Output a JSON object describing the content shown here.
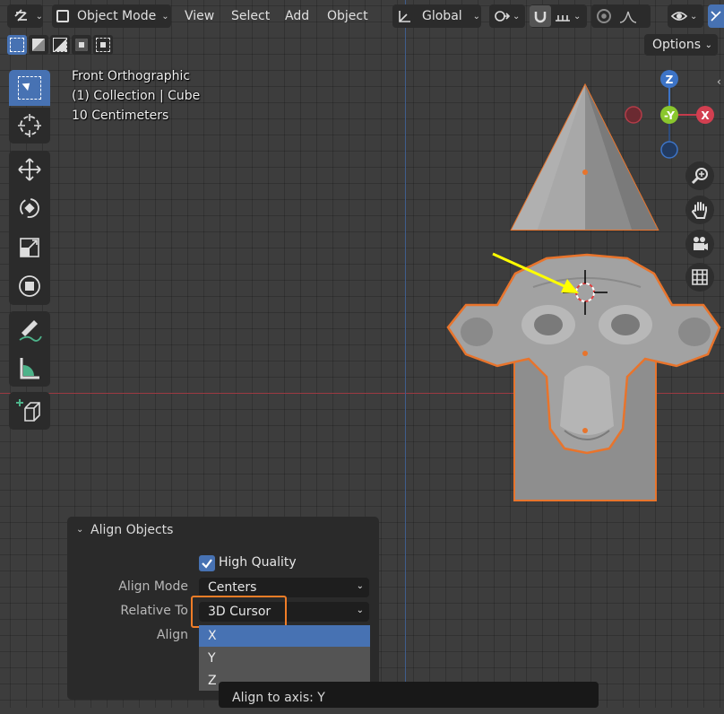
{
  "header": {
    "mode_label": "Object Mode",
    "menu_view": "View",
    "menu_select": "Select",
    "menu_add": "Add",
    "menu_object": "Object",
    "orientation_label": "Global"
  },
  "options_label": "Options",
  "overlay": {
    "view_name": "Front Orthographic",
    "collection": "(1) Collection | Cube",
    "scale": "10 Centimeters"
  },
  "gizmo": {
    "z_label": "Z",
    "y_label": "-Y",
    "x_label": "X"
  },
  "panel": {
    "title": "Align Objects",
    "high_quality_label": "High Quality",
    "align_mode_label": "Align Mode",
    "align_mode_value": "Centers",
    "relative_to_label": "Relative To",
    "relative_to_value": "3D Cursor",
    "align_label": "Align"
  },
  "dropdown_options": [
    "X",
    "Y",
    "Z"
  ],
  "tooltip": "Align to axis:  Y",
  "colors": {
    "accent": "#4772b3",
    "highlight": "#f07d27",
    "selection_outline": "#e8742c",
    "arrow": "#ffff00"
  }
}
